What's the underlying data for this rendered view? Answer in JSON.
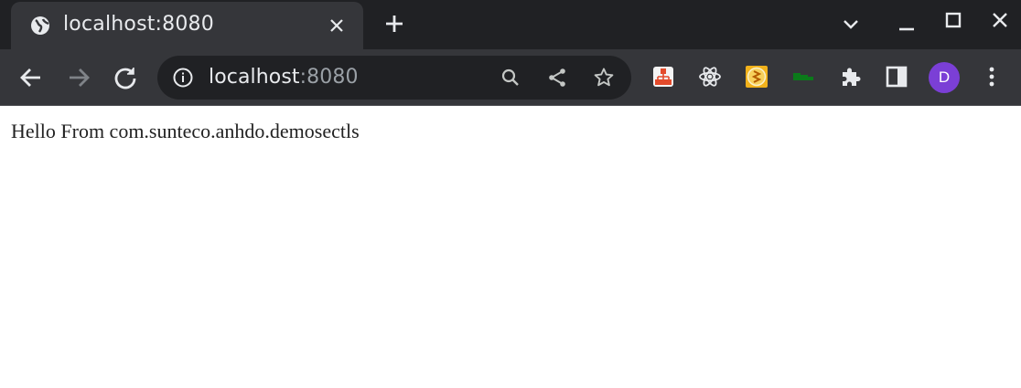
{
  "tab": {
    "title": "localhost:8080",
    "favicon": "globe-icon"
  },
  "omnibox": {
    "host": "localhost",
    "port": ":8080"
  },
  "profile": {
    "initial": "D",
    "color": "#7b3fd6"
  },
  "page": {
    "text": "Hello From com.sunteco.anhdo.demosectls"
  },
  "colors": {
    "tabstrip": "#202124",
    "toolbar": "#35363a",
    "omnibox": "#202124"
  }
}
